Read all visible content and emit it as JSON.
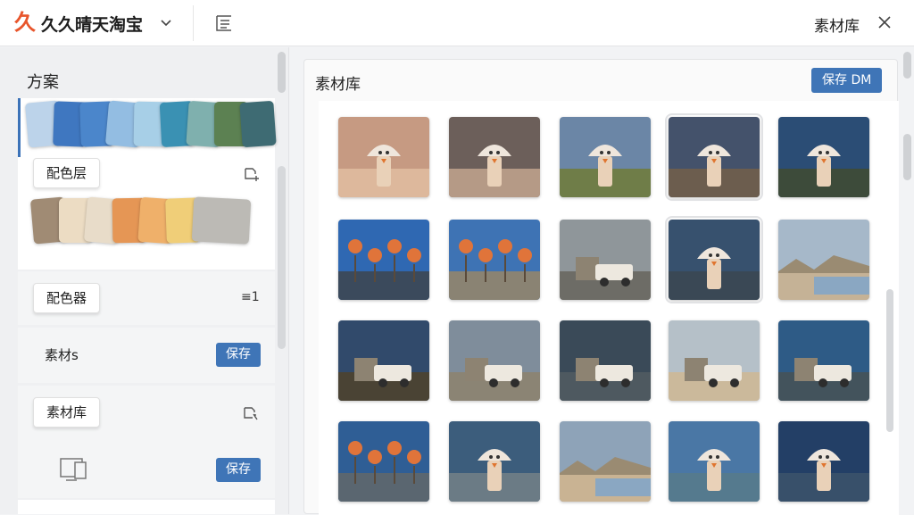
{
  "header": {
    "logo_glyph": "久",
    "app_title": "久久晴天淘宝",
    "library_title": "素材库"
  },
  "left_panel": {
    "title": "方案",
    "section1": {
      "pill_label": "配色层",
      "swatch_row1": [
        "#bcd3ea",
        "#3f77c0",
        "#4b86cb",
        "#93bde2",
        "#a7cfe7",
        "#3a91b3",
        "#7fb0ae",
        "#5c8152",
        "#3e6b73"
      ],
      "swatch_row2": [
        "#a08b74",
        "#ecdcc3",
        "#e8dcc9",
        "#e59655",
        "#efb06a",
        "#f0ce78",
        "#bcbab5"
      ]
    },
    "section2": {
      "pill_label": "配色器",
      "count": "≡1"
    },
    "section3": {
      "label": "素材s",
      "save_label": "保存"
    },
    "section4": {
      "pill_label": "素材库",
      "save_label": "保存"
    }
  },
  "right_panel": {
    "title": "素材库",
    "save_dm_label": "保存 DM",
    "thumbnails": [
      {
        "sky": "#c69a82",
        "ground": "#ddb89c",
        "subject": "figure"
      },
      {
        "sky": "#6c5f5a",
        "ground": "#b59a86",
        "subject": "figure"
      },
      {
        "sky": "#6b86a6",
        "ground": "#6f7d48",
        "subject": "figure"
      },
      {
        "sky": "#44526b",
        "ground": "#6c5d4e",
        "subject": "figure"
      },
      {
        "sky": "#2b4d75",
        "ground": "#3d4b3a",
        "subject": "figure"
      },
      {
        "sky": "#2f68b2",
        "ground": "#3b4a5c",
        "subject": "lamps"
      },
      {
        "sky": "#3e73b4",
        "ground": "#8a8373",
        "subject": "lamps"
      },
      {
        "sky": "#8f969a",
        "ground": "#6d6c66",
        "subject": "truck"
      },
      {
        "sky": "#37516e",
        "ground": "#3a4855",
        "subject": "figure"
      },
      {
        "sky": "#a6b8c9",
        "ground": "#c5b296",
        "subject": "landscape"
      },
      {
        "sky": "#314a6b",
        "ground": "#4a4334",
        "subject": "truck"
      },
      {
        "sky": "#7f8d9b",
        "ground": "#8b8474",
        "subject": "truck"
      },
      {
        "sky": "#3a4a58",
        "ground": "#4e5960",
        "subject": "truck"
      },
      {
        "sky": "#b5c0c8",
        "ground": "#cbb99b",
        "subject": "truck"
      },
      {
        "sky": "#2e5b86",
        "ground": "#43535c",
        "subject": "truck"
      },
      {
        "sky": "#2f5e95",
        "ground": "#5a6670",
        "subject": "lamps"
      },
      {
        "sky": "#3c5d7c",
        "ground": "#6b7b85",
        "subject": "figure"
      },
      {
        "sky": "#8ea3b8",
        "ground": "#c9b393",
        "subject": "landscape"
      },
      {
        "sky": "#4a77a5",
        "ground": "#557a8e",
        "subject": "figure"
      },
      {
        "sky": "#233f66",
        "ground": "#38506a",
        "subject": "figure"
      }
    ]
  }
}
